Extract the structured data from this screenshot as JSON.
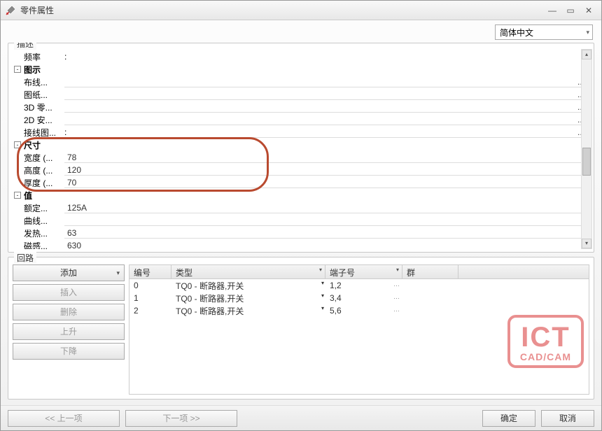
{
  "window": {
    "title": "零件属性"
  },
  "language": {
    "selected": "简体中文"
  },
  "description_group": {
    "label": "描述"
  },
  "props": {
    "frequency_label": "频率",
    "tushi_label": "图示",
    "buxian_label": "布线...",
    "tuzhi_label": "图纸...",
    "threed_label": "3D 零...",
    "twod_label": "2D 安...",
    "jiexian_label": "接线图...",
    "chicun_label": "尺寸",
    "width_label": "宽度 (...",
    "width_value": "78",
    "height_label": "高度 (...",
    "height_value": "120",
    "thick_label": "厚度 (...",
    "thick_value": "70",
    "zhi_label": "值",
    "eding_label": "额定...",
    "eding_value": "125A",
    "quxian_label": "曲线...",
    "fare_label": "发热...",
    "fare_value": "63",
    "cigan_label": "磁感...",
    "cigan_value": "630"
  },
  "dots": "...",
  "circuit_group": {
    "label": "回路"
  },
  "buttons": {
    "add": "添加",
    "insert": "插入",
    "delete": "删除",
    "up": "上升",
    "down": "下降"
  },
  "grid": {
    "headers": {
      "num": "编号",
      "type": "类型",
      "terminal": "端子号",
      "group": "群"
    },
    "rows": [
      {
        "num": "0",
        "type": "TQ0 - 断路器,开关",
        "terminal": "1,2"
      },
      {
        "num": "1",
        "type": "TQ0 - 断路器,开关",
        "terminal": "3,4"
      },
      {
        "num": "2",
        "type": "TQ0 - 断路器,开关",
        "terminal": "5,6"
      }
    ]
  },
  "footer": {
    "prev": "<< 上一项",
    "next": "下一项 >>",
    "ok": "确定",
    "cancel": "取消"
  },
  "watermark": {
    "big": "ICT",
    "small": "CAD/CAM"
  }
}
